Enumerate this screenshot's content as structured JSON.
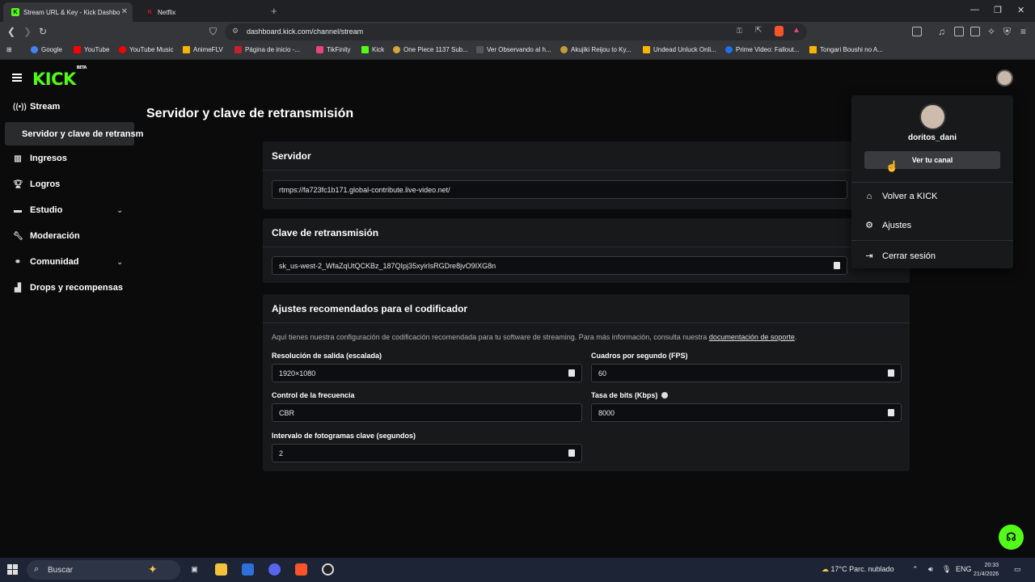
{
  "browser": {
    "tabs": [
      {
        "title": "Stream URL & Key - Kick Dashbo",
        "active": true
      },
      {
        "title": "Netflix",
        "active": false
      }
    ],
    "url": "dashboard.kick.com/channel/stream",
    "bookmarks": [
      "Google",
      "YouTube",
      "YouTube Music",
      "AnimeFLV",
      "Página de inicio -...",
      "TikFinity",
      "Kick",
      "One Piece 1137 Sub...",
      "Ver Observando al h...",
      "Akujiki Reijou to Ky...",
      "Undead Unluck Onli...",
      "Prime Video: Fallout...",
      "Tongari Boushi no A..."
    ]
  },
  "app": {
    "logo": "KICK",
    "logo_badge": "BETA",
    "brand_color": "#53fc18"
  },
  "sidebar": {
    "items": [
      {
        "label": "Stream",
        "icon": "broadcast-icon"
      },
      {
        "label": "Servidor y clave de retransm",
        "icon": ""
      },
      {
        "label": "Ingresos",
        "icon": "chart-icon"
      },
      {
        "label": "Logros",
        "icon": "trophy-icon"
      },
      {
        "label": "Estudio",
        "icon": "studio-icon"
      },
      {
        "label": "Moderación",
        "icon": "wrench-icon"
      },
      {
        "label": "Comunidad",
        "icon": "community-icon"
      },
      {
        "label": "Drops y recompensas",
        "icon": "drops-icon"
      }
    ]
  },
  "main": {
    "title": "Servidor y clave de retransmisión",
    "server": {
      "heading": "Servidor",
      "value": "rtmps://fa723fc1b171.global-contribute.live-video.net/"
    },
    "key": {
      "heading": "Clave de retransmisión",
      "value": "sk_us-west-2_WfaZqUtQCKBz_187QIpj35xyirIsRGDre8jvO9IXG8n"
    },
    "encoder": {
      "heading": "Ajustes recomendados para el codificador",
      "description": "Aquí tienes nuestra configuración de codificación recomendada para tu software de streaming. Para más información, consulta nuestra ",
      "link": "documentación de soporte",
      "period": ".",
      "resolution_label": "Resolución de salida (escalada)",
      "resolution_value": "1920×1080",
      "fps_label": "Cuadros por segundo (FPS)",
      "fps_value": "60",
      "rate_control_label": "Control de la frecuencia",
      "rate_control_value": "CBR",
      "bitrate_label": "Tasa de bits (Kbps)",
      "bitrate_value": "8000",
      "keyframe_label": "Intervalo de fotogramas clave (segundos)",
      "keyframe_value": "2"
    }
  },
  "user_menu": {
    "username": "doritos_dani",
    "view_channel": "Ver tu canal",
    "items": [
      {
        "label": "Volver a KICK",
        "icon": "home-icon"
      },
      {
        "label": "Ajustes",
        "icon": "gear-icon"
      },
      {
        "label": "Cerrar sesión",
        "icon": "logout-icon"
      }
    ]
  },
  "taskbar": {
    "search": "Buscar",
    "weather": "17°C  Parc. nublado",
    "lang": "ENG",
    "time": "20:33",
    "date": "21/4/2026"
  }
}
